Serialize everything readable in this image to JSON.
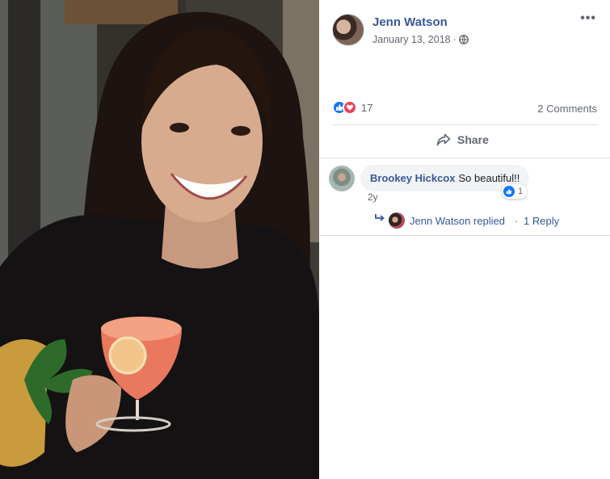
{
  "post": {
    "author": "Jenn Watson",
    "date": "January 13, 2018",
    "privacy_icon": "globe-icon",
    "menu_icon": "more-options-icon"
  },
  "reactions": {
    "types": [
      "like",
      "love"
    ],
    "count": "17",
    "comments_label": "2 Comments",
    "colors": {
      "like": "#1877f2",
      "love": "#f33e58"
    }
  },
  "actions": {
    "share_label": "Share",
    "share_icon": "share-arrow-icon"
  },
  "comments": [
    {
      "author": "Brookey Hickcox",
      "text": "So beautiful!!",
      "time": "2y",
      "reaction_count": "1",
      "replies": {
        "replier": "Jenn Watson replied",
        "separator": "·",
        "count_label": "1 Reply"
      }
    }
  ],
  "theme": {
    "link_color": "#385898",
    "muted_text": "#606770",
    "bubble_bg": "#f2f3f5"
  }
}
